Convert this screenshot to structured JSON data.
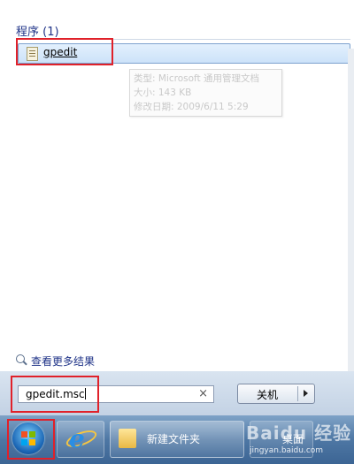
{
  "programs": {
    "header": "程序 (1)",
    "items": [
      {
        "label": "gpedit",
        "icon": "document-icon"
      }
    ]
  },
  "tooltip": {
    "lines": [
      "类型: Microsoft 通用管理文档",
      "大小: 143 KB",
      "修改日期: 2009/6/11 5:29"
    ]
  },
  "more_results": {
    "label": "查看更多结果",
    "icon": "search-icon"
  },
  "search": {
    "value": "gpedit.msc",
    "clear_symbol": "×"
  },
  "shutdown": {
    "label": "关机"
  },
  "taskbar": {
    "folder_label": "新建文件夹",
    "desktop_label": "桌面"
  },
  "watermark": {
    "logo_text": "Baidu 经验",
    "url": "jingyan.baidu.com"
  },
  "colors": {
    "highlight_box": "#e0212a",
    "link_text": "#1e3287"
  }
}
